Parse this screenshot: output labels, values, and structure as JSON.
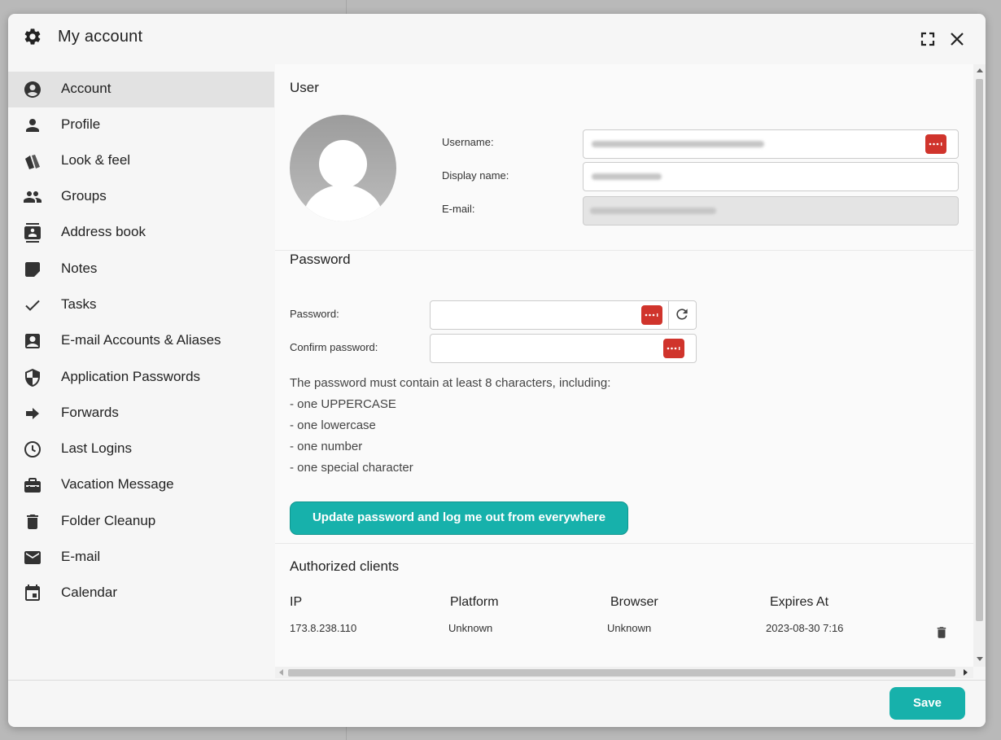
{
  "dialog": {
    "title": "My account",
    "title_icon": "gear-icon",
    "maximize_icon": "maximize-icon",
    "close_icon": "close-icon"
  },
  "sidebar": {
    "items": [
      {
        "label": "Account",
        "icon": "account-circle-icon",
        "active": true
      },
      {
        "label": "Profile",
        "icon": "person-icon"
      },
      {
        "label": "Look & feel",
        "icon": "swatches-icon"
      },
      {
        "label": "Groups",
        "icon": "group-icon"
      },
      {
        "label": "Address book",
        "icon": "contacts-icon"
      },
      {
        "label": "Notes",
        "icon": "note-icon"
      },
      {
        "label": "Tasks",
        "icon": "check-icon"
      },
      {
        "label": "E-mail Accounts & Aliases",
        "icon": "contact-card-icon"
      },
      {
        "label": "Application Passwords",
        "icon": "shield-icon"
      },
      {
        "label": "Forwards",
        "icon": "arrow-right-icon"
      },
      {
        "label": "Last Logins",
        "icon": "clock-icon"
      },
      {
        "label": "Vacation Message",
        "icon": "suitcase-icon"
      },
      {
        "label": "Folder Cleanup",
        "icon": "trash-icon"
      },
      {
        "label": "E-mail",
        "icon": "envelope-icon"
      },
      {
        "label": "Calendar",
        "icon": "calendar-icon"
      }
    ]
  },
  "user": {
    "section_title": "User",
    "username_label": "Username:",
    "display_name_label": "Display name:",
    "email_label": "E-mail:"
  },
  "password": {
    "section_title": "Password",
    "password_label": "Password:",
    "confirm_label": "Confirm password:",
    "hint_lines": [
      "The password must contain at least 8 characters, including:",
      "- one UPPERCASE",
      "- one lowercase",
      "- one number",
      "- one special character"
    ],
    "update_button": "Update password and log me out from everywhere"
  },
  "clients": {
    "section_title": "Authorized clients",
    "columns": [
      "IP",
      "Platform",
      "Browser",
      "Expires At"
    ],
    "rows": [
      {
        "ip": "173.8.238.110",
        "platform": "Unknown",
        "browser": "Unknown",
        "expires": "2023-08-30 7:16"
      }
    ]
  },
  "footer": {
    "save_label": "Save"
  },
  "colors": {
    "accent": "#17b1ab",
    "password_manager": "#d0342c"
  }
}
